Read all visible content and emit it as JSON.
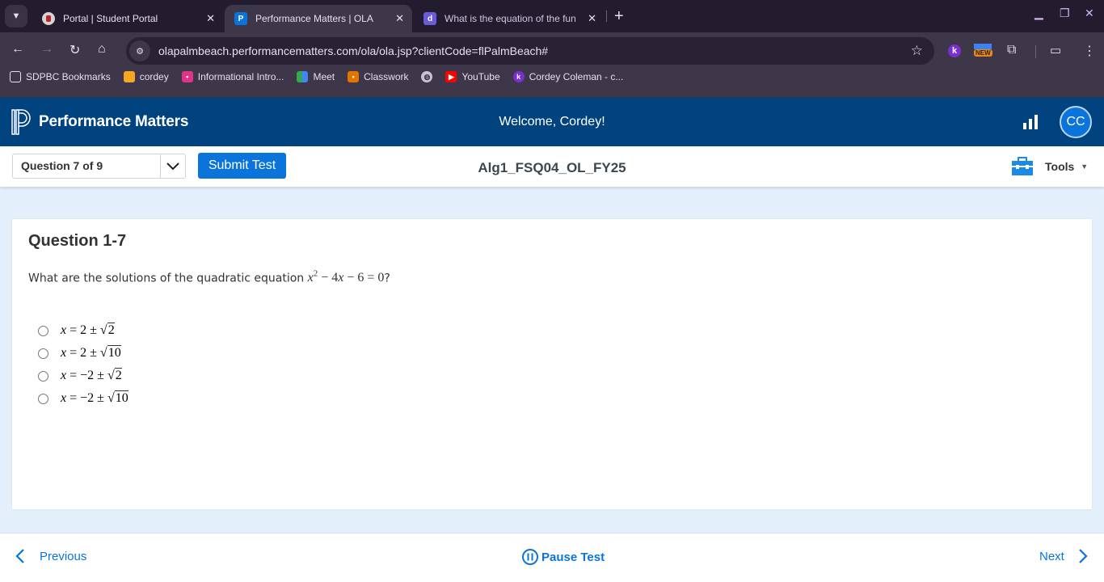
{
  "browser": {
    "tabs": [
      {
        "title": "Portal | Student Portal",
        "icon": "school-crest-icon",
        "active": false
      },
      {
        "title": "Performance Matters | OLA",
        "icon": "performance-matters-icon",
        "active": true
      },
      {
        "title": "What is the equation of the fun",
        "icon": "math-site-icon",
        "active": false
      }
    ],
    "url": "olapalmbeach.performancematters.com/ola/ola.jsp?clientCode=flPalmBeach#",
    "extension_badge": "NEW",
    "bookmarks": [
      {
        "label": "SDPBC Bookmarks",
        "icon": "folder-icon",
        "color": "#e6e0f0"
      },
      {
        "label": "cordey",
        "icon": "cube-icon",
        "color": "#f5a623"
      },
      {
        "label": "Informational Intro...",
        "icon": "classroom-icon",
        "color": "#e0338a"
      },
      {
        "label": "Meet",
        "icon": "meet-icon",
        "color": "#34a853"
      },
      {
        "label": "Classwork",
        "icon": "classwork-icon",
        "color": "#e37400"
      },
      {
        "label": "",
        "icon": "globe-icon",
        "color": "#c9c2d3"
      },
      {
        "label": "YouTube",
        "icon": "youtube-icon",
        "color": "#ff0000"
      },
      {
        "label": "Cordey Coleman - c...",
        "icon": "k-icon",
        "color": "#7b2fd0"
      }
    ]
  },
  "header": {
    "brand": "Performance Matters",
    "welcome": "Welcome, Cordey!",
    "avatar_initials": "CC"
  },
  "subheader": {
    "question_selector": "Question 7 of 9",
    "submit_label": "Submit Test",
    "test_name": "Alg1_FSQ04_OL_FY25",
    "tools_label": "Tools"
  },
  "question": {
    "title": "Question 1-7",
    "prompt_text": "What are the solutions of the quadratic equation",
    "prompt_math": {
      "var": "x",
      "exp": "2",
      "rest": " − 4",
      "var2": "x",
      "tail": " − 6 = 0"
    },
    "prompt_end": "?",
    "options": [
      {
        "lhs": "x",
        "middle": " = 2 ± ",
        "radicand": "2"
      },
      {
        "lhs": "x",
        "middle": " = 2 ± ",
        "radicand": "10"
      },
      {
        "lhs": "x",
        "middle": " = −2 ± ",
        "radicand": "2"
      },
      {
        "lhs": "x",
        "middle": " = −2 ± ",
        "radicand": "10"
      }
    ]
  },
  "footer": {
    "previous_label": "Previous",
    "pause_label": "Pause Test",
    "next_label": "Next"
  },
  "colors": {
    "header_bg": "#00437e",
    "accent": "#0a74da",
    "page_bg": "#e3f0fb"
  }
}
